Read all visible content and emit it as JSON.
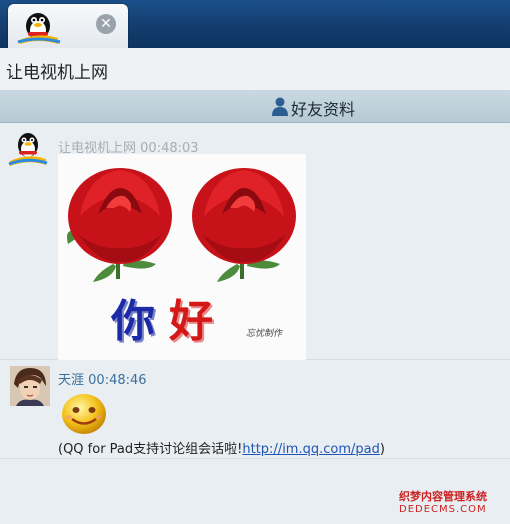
{
  "tab": {
    "close_symbol": "✕",
    "avatar_icon": "qq-penguin-icon"
  },
  "title": "让电视机上网",
  "friend_info_label": "好友资料",
  "messages": [
    {
      "sender": "让电视机上网",
      "time": "00:48:03",
      "image_text": "你好",
      "image_text_chars": [
        "你",
        "好"
      ],
      "signature": "忘忧制作"
    },
    {
      "sender": "天涯",
      "time": "00:48:46",
      "line_prefix": "(QQ for Pad支持讨论组会话啦!",
      "link": "http://im.qq.com/pad",
      "line_suffix": ")"
    }
  ],
  "watermark": {
    "line1": "织梦内容管理系统",
    "line2": "DEDECMS.COM"
  },
  "colors": {
    "tabbar": "#123c6c",
    "infobar": "#c9d9e1",
    "link": "#1f55b5",
    "sender_name": "#3a6f9c"
  }
}
